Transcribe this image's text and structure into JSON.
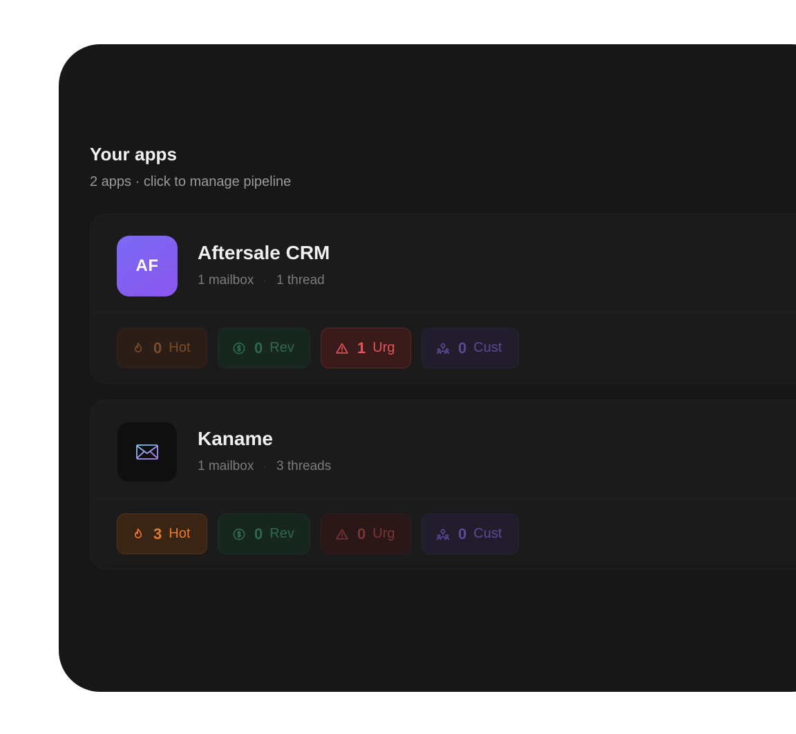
{
  "section": {
    "title": "Your apps",
    "subtitle": "2 apps · click to manage pipeline"
  },
  "apps": [
    {
      "icon_initials": "AF",
      "name": "Aftersale CRM",
      "mailboxes": "1 mailbox",
      "separator": "·",
      "threads": "1 thread",
      "badges": {
        "hot": {
          "count": "0",
          "label": "Hot",
          "icon": "flame-icon"
        },
        "rev": {
          "count": "0",
          "label": "Rev",
          "icon": "dollar-circle-icon"
        },
        "urg": {
          "count": "1",
          "label": "Urg",
          "icon": "warning-triangle-icon"
        },
        "cust": {
          "count": "0",
          "label": "Cust",
          "icon": "users-icon"
        }
      }
    },
    {
      "icon_initials": "",
      "icon": "envelope-icon",
      "name": "Kaname",
      "mailboxes": "1 mailbox",
      "separator": "·",
      "threads": "3 threads",
      "badges": {
        "hot": {
          "count": "3",
          "label": "Hot",
          "icon": "flame-icon"
        },
        "rev": {
          "count": "0",
          "label": "Rev",
          "icon": "dollar-circle-icon"
        },
        "urg": {
          "count": "0",
          "label": "Urg",
          "icon": "warning-triangle-icon"
        },
        "cust": {
          "count": "0",
          "label": "Cust",
          "icon": "users-icon"
        }
      }
    }
  ],
  "colors": {
    "panel_bg": "#171717",
    "hot_active": "#e87a2e",
    "urg_active": "#e85454",
    "rev": "#2c6a4c",
    "cust": "#5b4a96",
    "af_gradient_start": "#7a6af5",
    "af_gradient_end": "#8b56ee"
  }
}
